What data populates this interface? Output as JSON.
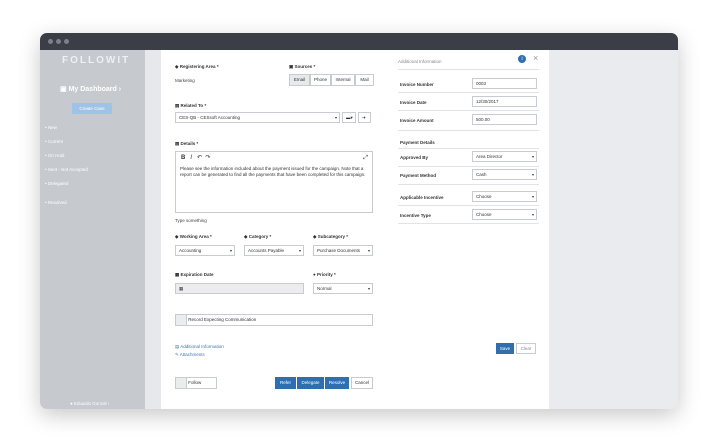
{
  "app": {
    "logo": "FOLLOWIT"
  },
  "sidebar": {
    "dashboard": "My Dashboard",
    "create_case": "Create Case",
    "items": [
      "New",
      "Current",
      "On Hold",
      "Sent - Not Accepted",
      "Delegated",
      "Resolved"
    ],
    "user": "Eduardo Gonzal"
  },
  "form": {
    "registering_area_label": "Registering Area",
    "registering_area_value": "Marketing",
    "sources_label": "Sources",
    "sources": [
      "Email",
      "Phone",
      "Internal",
      "Mail"
    ],
    "related_to_label": "Related To",
    "related_to_value": "CES-QB - CESsoft Accounting",
    "details_label": "Details",
    "details_text": "Please see the information included about the payment issued for the campaign. Note that a report can be generated to find all the payments that have been completed for this campaign.",
    "details_placeholder": "Type something",
    "working_area_label": "Working Area",
    "working_area_value": "Accounting",
    "category_label": "Category",
    "category_value": "Accounts Payable",
    "subcategory_label": "Subcategory",
    "subcategory_value": "Purchase Documents",
    "expiration_label": "Expiration Date",
    "priority_label": "Priority",
    "priority_value": "Normal",
    "record_label": "Record Expecting Communication",
    "additional_info_link": "Additional Information",
    "attachments_link": "Attachments",
    "follow_label": "Follow",
    "refer_label": "Refer",
    "delegate_label": "Delegate",
    "resolve_label": "Resolve",
    "cancel_label": "Cancel"
  },
  "additional": {
    "title": "Additional Information",
    "invoice_number_label": "Invoice Number",
    "invoice_number_value": "0003",
    "invoice_date_label": "Invoice Date",
    "invoice_date_value": "12/30/2017",
    "invoice_amount_label": "Invoice Amount",
    "invoice_amount_value": "500.00",
    "payment_details_label": "Payment Details",
    "approved_by_label": "Approved By",
    "approved_by_value": "Area Director",
    "payment_method_label": "Payment Method",
    "payment_method_value": "Cash",
    "applicable_incentive_label": "Applicable Incentive",
    "applicable_incentive_value": "Choose",
    "incentive_type_label": "Incentive Type",
    "incentive_type_value": "Choose",
    "save_label": "Save",
    "clear_label": "Clear"
  }
}
